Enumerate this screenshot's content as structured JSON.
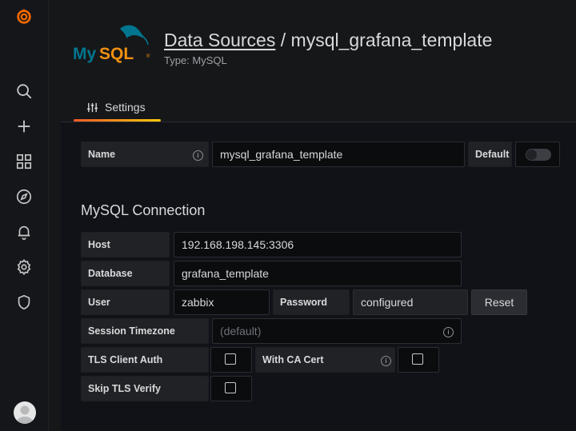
{
  "header": {
    "breadcrumb_link": "Data Sources",
    "separator": "/",
    "name": "mysql_grafana_template",
    "subtitle": "Type: MySQL",
    "logo_text": "MySQL"
  },
  "tabs": [
    {
      "label": "Settings",
      "icon": "sliders-icon",
      "active": true
    }
  ],
  "sidebar": {
    "items": [
      {
        "icon": "grafana-logo"
      },
      {
        "icon": "search-icon"
      },
      {
        "icon": "plus-icon"
      },
      {
        "icon": "dashboards-grid-icon"
      },
      {
        "icon": "explore-compass-icon"
      },
      {
        "icon": "alerting-bell-icon"
      },
      {
        "icon": "configuration-gear-icon"
      },
      {
        "icon": "server-admin-shield-icon"
      },
      {
        "icon": "user-avatar"
      }
    ]
  },
  "name_field": {
    "label": "Name",
    "value": "mysql_grafana_template",
    "default_label": "Default",
    "default_on": false
  },
  "connection": {
    "title": "MySQL Connection",
    "host_label": "Host",
    "host_value": "192.168.198.145:3306",
    "database_label": "Database",
    "database_value": "grafana_template",
    "user_label": "User",
    "user_value": "zabbix",
    "password_label": "Password",
    "password_value": "configured",
    "reset_label": "Reset",
    "timezone_label": "Session Timezone",
    "timezone_placeholder": "(default)",
    "tls_client_auth_label": "TLS Client Auth",
    "tls_client_auth_checked": false,
    "with_ca_cert_label": "With CA Cert",
    "with_ca_cert_checked": false,
    "skip_tls_label": "Skip TLS Verify",
    "skip_tls_checked": false
  },
  "colors": {
    "accent_orange": "#f05a28",
    "accent_yellow": "#fbca0a",
    "mysql_blue": "#00758f",
    "mysql_orange": "#f29111"
  }
}
